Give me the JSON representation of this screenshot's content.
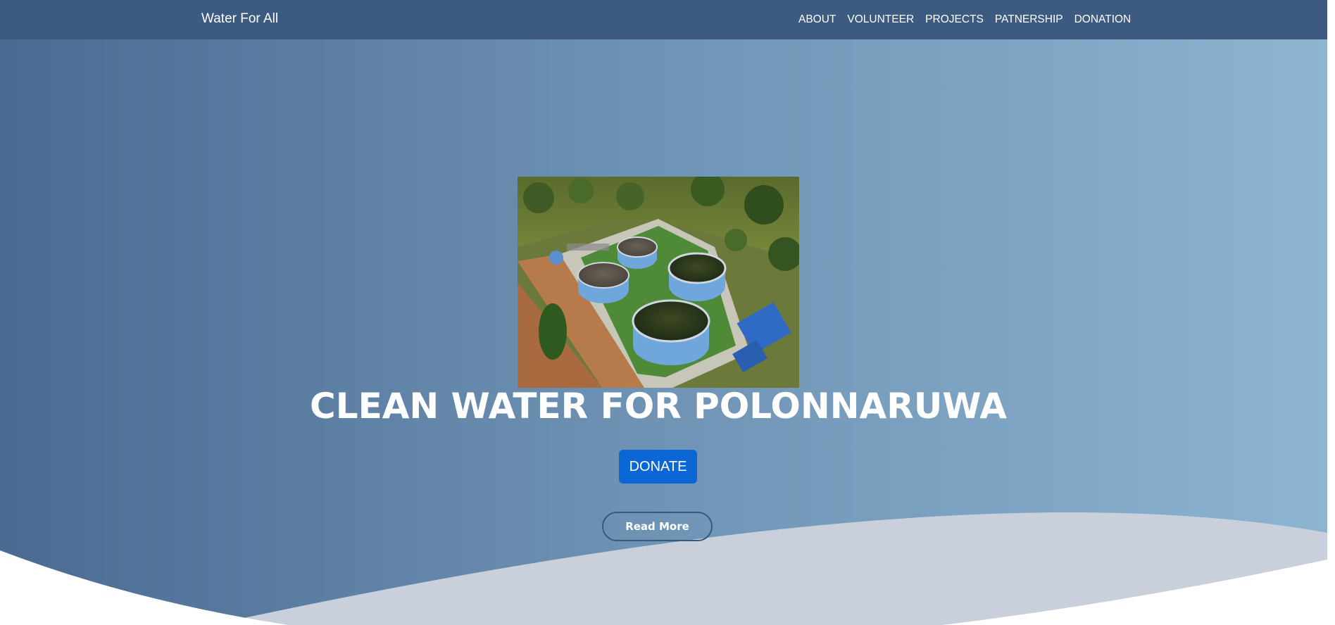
{
  "nav": {
    "brand": "Water For All",
    "links": [
      "ABOUT",
      "VOLUNTEER",
      "PROJECTS",
      "PATNERSHIP",
      "DONATION"
    ]
  },
  "hero": {
    "image_subject": "aerial-photo-water-treatment-tanks",
    "title": "CLEAN WATER FOR POLONNARUWA",
    "donate_label": "DONATE",
    "read_more_label": "Read More"
  },
  "colors": {
    "navbar": "#3d5a80",
    "gradient_start": "#4b6a92",
    "gradient_end": "#8db4d1",
    "donate_button": "#0b67d6",
    "curve_shadow": "#c9d0dc"
  }
}
